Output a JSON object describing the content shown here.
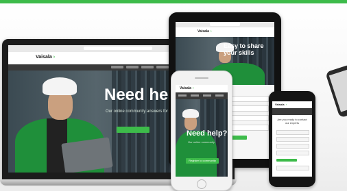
{
  "brand": {
    "logo_text": "Vaisala",
    "accent_color": "#3dbb4a",
    "chevron_icon": "chevron-right-icon"
  },
  "laptop": {
    "hero_title": "Need help?",
    "hero_subtitle": "Our online community answers for you"
  },
  "tablet": {
    "hero_title": "Easy to share your skills"
  },
  "phone_white": {
    "hero_title": "Need help?",
    "hero_subtitle": "Our online community",
    "cta_label": "Register to community"
  },
  "phone_black": {
    "form_title": "Are you ready to contact our experts"
  }
}
